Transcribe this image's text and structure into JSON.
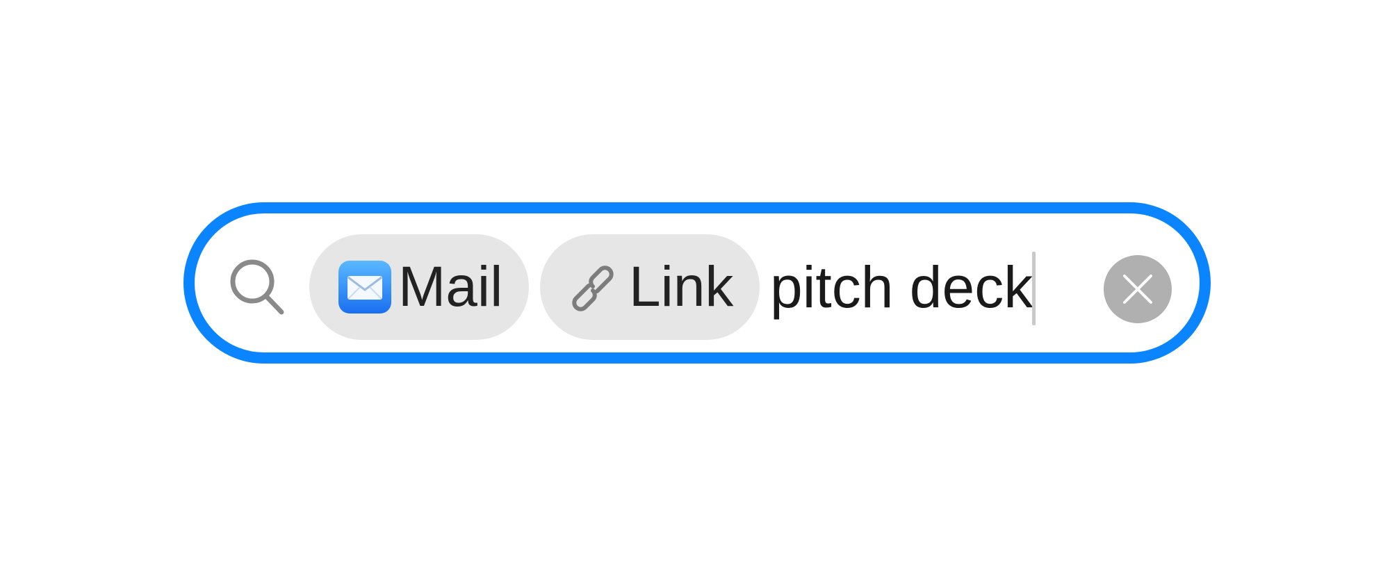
{
  "search_bar": {
    "accent_color": "#0a84ff",
    "search_icon": "magnifying-glass-icon",
    "tokens": [
      {
        "label": "Mail",
        "icon": "mail-app-icon"
      },
      {
        "label": "Link",
        "icon": "link-icon"
      }
    ],
    "query": "pitch deck",
    "clear_icon": "clear-x-icon"
  }
}
